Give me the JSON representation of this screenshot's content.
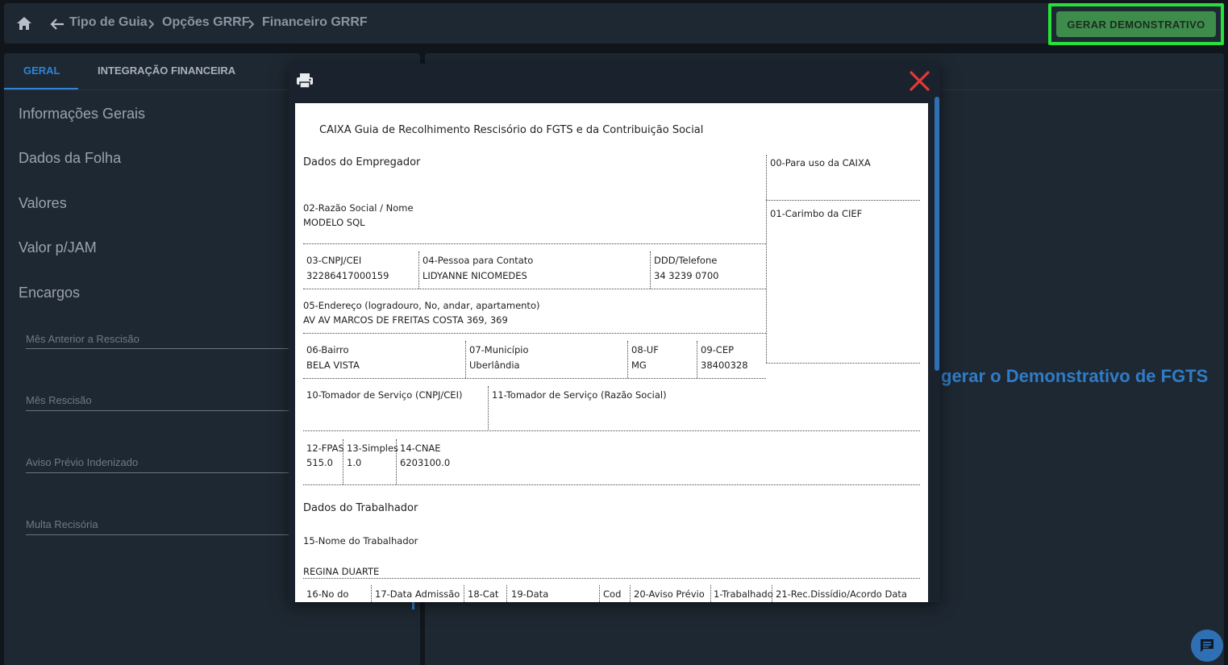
{
  "topbar": {
    "breadcrumbs": [
      "Tipo de Guia",
      "Opções GRRF",
      "Financeiro GRRF"
    ],
    "generate_button": "GERAR DEMONSTRATIVO",
    "accent_color": "#27e03a"
  },
  "tabs": [
    {
      "label": "GERAL",
      "active": true
    },
    {
      "label": "INTEGRAÇÃO FINANCEIRA",
      "active": false
    }
  ],
  "sections": [
    "Informações Gerais",
    "Dados da Folha",
    "Valores",
    "Valor p/JAM",
    "Encargos"
  ],
  "fields": [
    {
      "label": "Mês Anterior a Rescisão",
      "value": ""
    },
    {
      "label": "Mês Rescisão",
      "value": ""
    },
    {
      "label": "Aviso Prévio Indenizado",
      "value": ""
    },
    {
      "label": "Multa Recisória",
      "value": ""
    }
  ],
  "right_hint": "gerar o Demonstrativo de FGTS",
  "document": {
    "title": "CAIXA Guia de Recolhimento Rescisório do FGTS e da Contribuição Social",
    "employer_header": "Dados do Empregador",
    "caixa_use_label": "00-Para uso da CAIXA",
    "cief_label": "01-Carimbo da CIEF",
    "razao_label": "02-Razão Social / Nome",
    "razao_value": "MODELO SQL",
    "cnpj_label": "03-CNPJ/CEI",
    "cnpj_value": "32286417000159",
    "contato_label": "04-Pessoa para Contato",
    "contato_value": "LIDYANNE NICOMEDES",
    "telefone_label": "DDD/Telefone",
    "telefone_value": "34 3239 0700",
    "endereco_label": "05-Endereço (logradouro, No, andar, apartamento)",
    "endereco_value": "AV AV MARCOS DE FREITAS COSTA 369, 369",
    "bairro_label": "06-Bairro",
    "bairro_value": "BELA VISTA",
    "municipio_label": "07-Município",
    "municipio_value": "Uberlândia",
    "uf_label": "08-UF",
    "uf_value": "MG",
    "cep_label": "09-CEP",
    "cep_value": "38400328",
    "tomador_cnpj_label": "10-Tomador de Serviço (CNPJ/CEI)",
    "tomador_razao_label": "11-Tomador de Serviço (Razão Social)",
    "fpas_label": "12-FPAS",
    "fpas_value": "515.0",
    "simples_label": "13-Simples",
    "simples_value": "1.0",
    "cnae_label": "14-CNAE",
    "cnae_value": "6203100.0",
    "worker_header": "Dados do Trabalhador",
    "nome_label": "15-Nome do Trabalhador",
    "nome_value": "REGINA DUARTE",
    "bottom_labels": [
      "16-No do",
      "17-Data Admissão",
      "18-Cat",
      "19-Data",
      "Cod",
      "20-Aviso Prévio",
      "1-Trabalhado",
      "21-Rec.Dissídio/Acordo Data"
    ]
  }
}
